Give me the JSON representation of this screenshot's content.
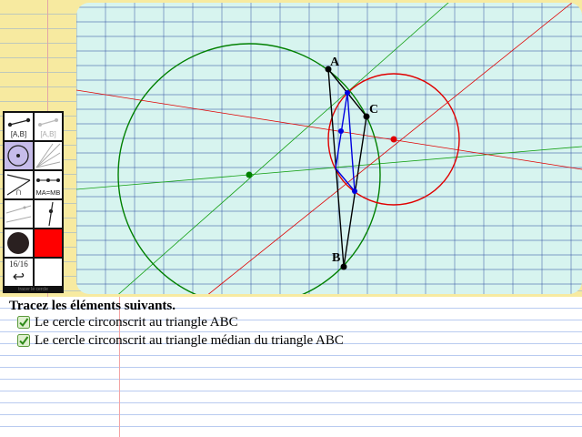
{
  "colors": {
    "grid_background": "#d7f4ef",
    "grid_lines": "#2e4f9e",
    "green": "#008000",
    "red": "#e00000",
    "blue": "#0000e0",
    "black": "#000000"
  },
  "figure": {
    "labels": {
      "A": "A",
      "B": "B",
      "C": "C"
    }
  },
  "toolbox": {
    "segment_label": "[A,B]",
    "segment_label_muted": "[A,B]",
    "equal_distance_label": "MA=MB",
    "angle_label": "∩",
    "page_counter": "16/16",
    "back_icon": "↩",
    "tiny_caption": "tracer le cercle"
  },
  "instructions": {
    "title": "Tracez les éléments suivants.",
    "tasks": [
      {
        "label": "Le cercle circonscrit au triangle ABC",
        "done": true
      },
      {
        "label": "Le cercle circonscrit au triangle médian du triangle ABC",
        "done": true
      }
    ]
  }
}
